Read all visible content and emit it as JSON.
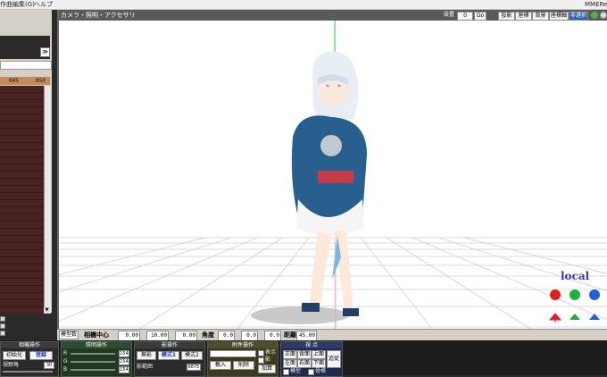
{
  "menubar": {
    "left_items": [
      "作曲編集(G)",
      "ヘルプ"
    ],
    "right_text": "MMERe"
  },
  "left_panel": {
    "collapse_label": "≫",
    "ruler": [
      "045",
      "050"
    ],
    "scroll_down": "▼"
  },
  "viewport": {
    "title": "カメラ・照明・アクセサリ",
    "toolbar": {
      "label_setting": "設置",
      "input_value": "0",
      "go_label": "Go",
      "buttons": [
        "投影",
        "座標",
        "背景",
        "座標軸",
        "非選択"
      ],
      "active_button": "非選択"
    },
    "local_label": "local",
    "colors": {
      "grid": "#c8c8c8",
      "axis_green": "#22cc22",
      "gizmo_red": "#e02020",
      "gizmo_green": "#20b040",
      "gizmo_blue": "#2060e0"
    }
  },
  "control_strip": {
    "tab_label": "模型数",
    "center_label": "相機中心",
    "center_x": "0.00",
    "center_y": "10.00",
    "center_z": "0.00",
    "angle_label": "角度",
    "angle_x": "0.0",
    "angle_y": "0.0",
    "angle_z": "0.0",
    "dist_label": "距離",
    "dist_value": "45.00"
  },
  "bottom_panels": {
    "panel1": {
      "title": "相機操作",
      "init_button": "初始化",
      "register_button": "登録",
      "fov_label": "視野角",
      "fov_value": "30"
    },
    "panel2": {
      "title": "照明操作",
      "labels": [
        "R",
        "G",
        "B"
      ],
      "values": [
        "154",
        "154",
        "154"
      ]
    },
    "panel3": {
      "title": "影操作",
      "buttons": [
        "無影",
        "模式1",
        "模式2"
      ],
      "active": "模式1",
      "dist_label": "影範囲",
      "dist_value": "8875"
    },
    "panel4": {
      "title": "附件操作",
      "buttons": [
        "載入",
        "削除"
      ],
      "checkbox_labels": [
        "表示",
        "影",
        "加算"
      ]
    },
    "panel5": {
      "title": "視 点",
      "buttons": [
        "正面",
        "背面",
        "上面",
        "左面",
        "右面",
        "下面"
      ],
      "side_button": "追従",
      "checkbox_labels": [
        "模型",
        "骨格"
      ]
    }
  }
}
